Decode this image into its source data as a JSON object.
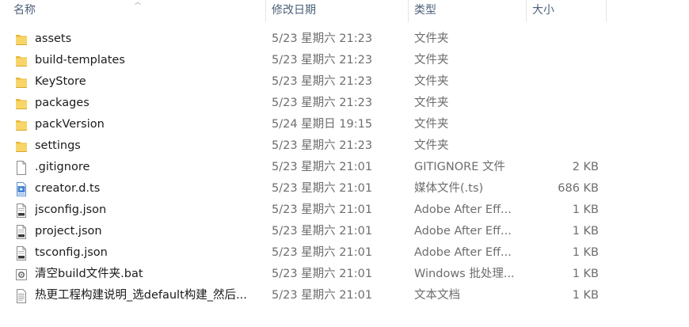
{
  "header": {
    "name": "名称",
    "date": "修改日期",
    "type": "类型",
    "size": "大小"
  },
  "files": [
    {
      "name": "assets",
      "date": "5/23 星期六 21:23",
      "type": "文件夹",
      "size": "",
      "icon": "folder-icon"
    },
    {
      "name": "build-templates",
      "date": "5/23 星期六 21:23",
      "type": "文件夹",
      "size": "",
      "icon": "folder-icon"
    },
    {
      "name": "KeyStore",
      "date": "5/23 星期六 21:23",
      "type": "文件夹",
      "size": "",
      "icon": "folder-icon"
    },
    {
      "name": "packages",
      "date": "5/23 星期六 21:23",
      "type": "文件夹",
      "size": "",
      "icon": "folder-icon"
    },
    {
      "name": "packVersion",
      "date": "5/24 星期日 19:15",
      "type": "文件夹",
      "size": "",
      "icon": "folder-icon"
    },
    {
      "name": "settings",
      "date": "5/23 星期六 21:23",
      "type": "文件夹",
      "size": "",
      "icon": "folder-icon"
    },
    {
      "name": ".gitignore",
      "date": "5/23 星期六 21:01",
      "type": "GITIGNORE 文件",
      "size": "2 KB",
      "icon": "blank-file-icon"
    },
    {
      "name": "creator.d.ts",
      "date": "5/23 星期六 21:01",
      "type": "媒体文件(.ts)",
      "size": "686 KB",
      "icon": "video-file-icon"
    },
    {
      "name": "jsconfig.json",
      "date": "5/23 星期六 21:01",
      "type": "Adobe After Eff...",
      "size": "1 KB",
      "icon": "json-file-icon"
    },
    {
      "name": "project.json",
      "date": "5/23 星期六 21:01",
      "type": "Adobe After Eff...",
      "size": "1 KB",
      "icon": "json-file-icon"
    },
    {
      "name": "tsconfig.json",
      "date": "5/23 星期六 21:01",
      "type": "Adobe After Eff...",
      "size": "1 KB",
      "icon": "json-file-icon"
    },
    {
      "name": "清空build文件夹.bat",
      "date": "5/23 星期六 21:01",
      "type": "Windows 批处理...",
      "size": "1 KB",
      "icon": "batch-file-icon"
    },
    {
      "name": "热更工程构建说明_选default构建_然后...",
      "date": "5/23 星期六 21:01",
      "type": "文本文档",
      "size": "1 KB",
      "icon": "text-file-icon"
    }
  ]
}
